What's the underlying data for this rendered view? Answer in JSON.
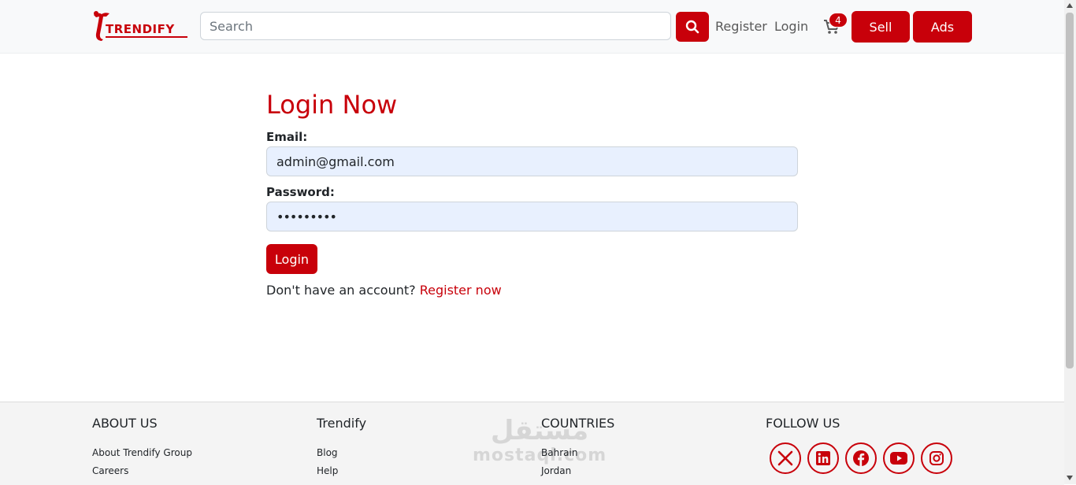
{
  "navbar": {
    "brand": "TRENDIFY",
    "search_placeholder": "Search",
    "register_label": "Register",
    "login_label": "Login",
    "cart_count": "4",
    "sell_label": "Sell",
    "ads_label": "Ads"
  },
  "login_form": {
    "title": "Login Now",
    "email_label": "Email:",
    "email_value": "admin@gmail.com",
    "password_label": "Password:",
    "password_value": "•••••••••",
    "submit_label": "Login",
    "register_prompt": "Don't have an account?",
    "register_link": "Register now"
  },
  "footer": {
    "about": {
      "heading": "ABOUT US",
      "links": [
        "About Trendify Group",
        "Careers"
      ]
    },
    "trendify": {
      "heading": "Trendify",
      "links": [
        "Blog",
        "Help"
      ]
    },
    "countries": {
      "heading": "COUNTRIES",
      "links": [
        "Bahrain",
        "Jordan"
      ]
    },
    "follow": {
      "heading": "FOLLOW US"
    },
    "social_icons": [
      "x-icon",
      "linkedin-icon",
      "facebook-icon",
      "youtube-icon",
      "instagram-icon"
    ]
  },
  "watermark": {
    "arabic": "مستقل",
    "latin": "mostaql.com"
  },
  "colors": {
    "brand": "#c8000a",
    "navbar_bg": "#f8f9fa",
    "input_autofill_bg": "#e8f0fe",
    "footer_bg": "#f4f4f4"
  }
}
